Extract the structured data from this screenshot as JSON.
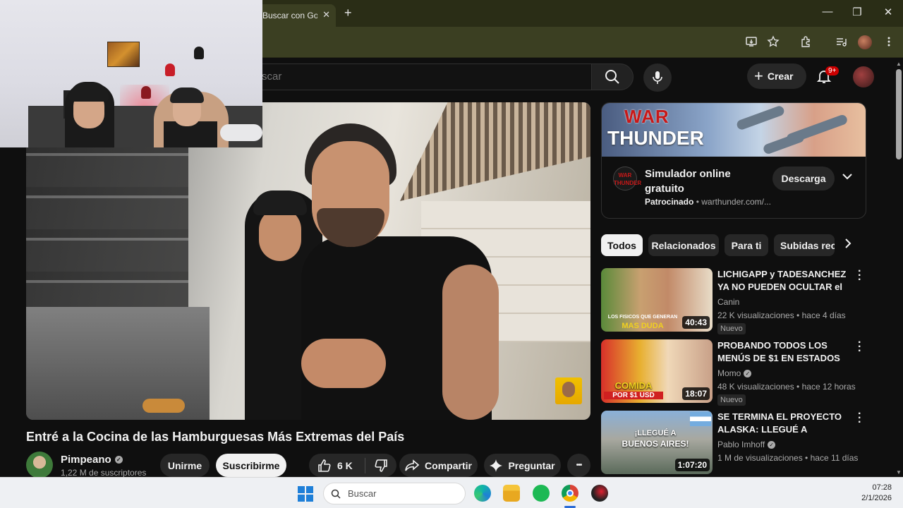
{
  "browser": {
    "tab_title": "Buscar con Goo",
    "tab_close": "✕",
    "new_tab": "+",
    "window_controls": {
      "minimize": "—",
      "maximize": "❐",
      "close": "✕"
    }
  },
  "youtube": {
    "search_placeholder": "scar",
    "create_label": "Crear",
    "notifications_badge": "9+"
  },
  "video": {
    "title": "Entré a la Cocina de las Hamburguesas Más Extremas del País",
    "channel_name": "Pimpeano",
    "subscribers": "1,22 M de suscriptores",
    "join_label": "Unirme",
    "subscribe_label": "Suscribirme",
    "likes": "6 K",
    "share_label": "Compartir",
    "ask_label": "Preguntar",
    "more_label": "•••"
  },
  "ad": {
    "banner_line1": "WAR",
    "banner_line2": "THUNDER",
    "icon_text": "WAR THUNDER",
    "title": "Simulador online gratuito",
    "sponsored": "Patrocinado",
    "url": "warthunder.com/...",
    "download_label": "Descarga"
  },
  "chips": [
    "Todos",
    "Relacionados",
    "Para ti",
    "Subidas reci"
  ],
  "recommendations": [
    {
      "title": "LICHIGAPP y TADESANCHEZ YA NO PUEDEN OCULTAR el ...",
      "channel": "Canin",
      "verified": false,
      "meta": "22 K visualizaciones • hace 4 días",
      "badge": "Nuevo",
      "duration": "40:43",
      "thumb_text1": "LOS FISICOS QUE GENERAN",
      "thumb_text2": "MAS DUDA"
    },
    {
      "title": "PROBANDO TODOS LOS MENÚS DE $1 EN ESTADOS ...",
      "channel": "Momo",
      "verified": true,
      "meta": "48 K visualizaciones • hace 12 horas",
      "badge": "Nuevo",
      "duration": "18:07",
      "thumb_text1": "COMIDA",
      "thumb_text2": "POR $1 USD"
    },
    {
      "title": "SE TERMINA EL PROYECTO ALASKA: LLEGUÉ A BUENOS ...",
      "channel": "Pablo Imhoff",
      "verified": true,
      "meta": "1 M de visualizaciones • hace 11 días",
      "badge": "",
      "duration": "1:07:20",
      "thumb_text1": "¡LLEGUÉ A",
      "thumb_text2": "BUENOS AIRES!"
    }
  ],
  "taskbar": {
    "search_label": "Buscar",
    "time": "07:28",
    "date": "2/1/2026"
  },
  "icons": [
    "search-icon",
    "mic-icon",
    "bell-icon",
    "like-icon",
    "dislike-icon",
    "share-icon",
    "sparkle-icon",
    "chevron-down-icon",
    "chevron-right-icon",
    "more-vert-icon",
    "windows-start-icon",
    "edge-icon",
    "file-explorer-icon",
    "spotify-icon",
    "chrome-icon",
    "app-icon"
  ],
  "colors": {
    "youtube_bg": "#0f0f0f",
    "browser_frame": "#3b3f22",
    "badge_red": "#cc0000",
    "taskbar": "#eef0f3"
  }
}
